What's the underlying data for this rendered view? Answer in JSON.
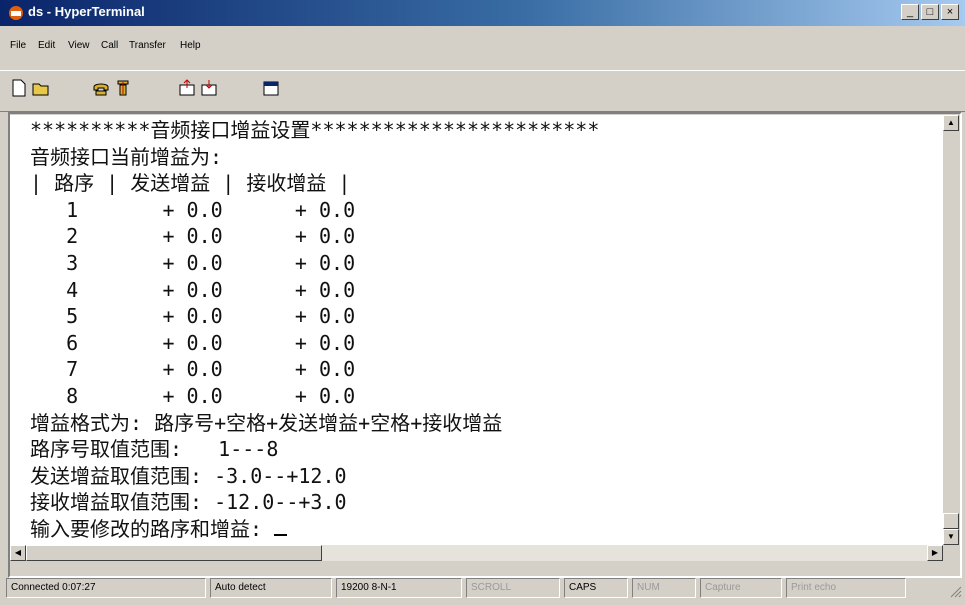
{
  "window": {
    "title": "ds - HyperTerminal"
  },
  "window_buttons": [
    "_",
    "□",
    "×"
  ],
  "menu": [
    "File",
    "Edit",
    "View",
    "Call",
    "Transfer",
    "Help"
  ],
  "toolbar": [
    "new-icon",
    "open-icon",
    "call-icon",
    "disconnect-icon",
    "send-icon",
    "receive-icon",
    "properties-icon"
  ],
  "terminal": {
    "lines": [
      "**********音频接口增益设置************************",
      "音频接口当前增益为:",
      "| 路序 | 发送增益 | 接收增益 |",
      "   1       + 0.0      + 0.0",
      "   2       + 0.0      + 0.0",
      "   3       + 0.0      + 0.0",
      "   4       + 0.0      + 0.0",
      "   5       + 0.0      + 0.0",
      "   6       + 0.0      + 0.0",
      "   7       + 0.0      + 0.0",
      "   8       + 0.0      + 0.0",
      "增益格式为: 路序号+空格+发送增益+空格+接收增益",
      "路序号取值范围:   1---8",
      "发送增益取值范围: -3.0--+12.0",
      "接收增益取值范围: -12.0--+3.0",
      "输入要修改的路序和增益: "
    ]
  },
  "status": {
    "connected": "Connected 0:07:27",
    "detect": "Auto detect",
    "settings": "19200 8-N-1",
    "scroll": "SCROLL",
    "caps": "CAPS",
    "num": "NUM",
    "capture": "Capture",
    "echo": "Print echo"
  }
}
